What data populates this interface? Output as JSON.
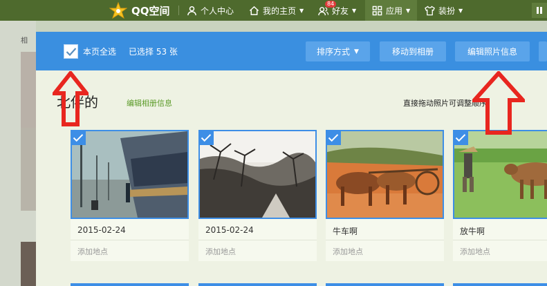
{
  "topnav": {
    "brand": "QQ空间",
    "items": [
      {
        "label": "个人中心"
      },
      {
        "label": "我的主页"
      },
      {
        "label": "好友",
        "badge": "84"
      },
      {
        "label": "应用"
      },
      {
        "label": "装扮"
      }
    ]
  },
  "background": {
    "char": "相"
  },
  "toolbar": {
    "select_all_label": "本页全选",
    "selected_count": "已选择 53 张",
    "sort_label": "排序方式",
    "move_label": "移动到相册",
    "edit_label": "编辑照片信息"
  },
  "album": {
    "title": "北伴的",
    "edit_link": "编辑相册信息",
    "drag_hint": "直接拖动照片可调整顺序"
  },
  "photos": [
    {
      "caption": "2015-02-24",
      "location_placeholder": "添加地点"
    },
    {
      "caption": "2015-02-24",
      "location_placeholder": "添加地点"
    },
    {
      "caption": "牛车啊",
      "location_placeholder": "添加地点"
    },
    {
      "caption": "放牛啊",
      "location_placeholder": "添加地点"
    }
  ],
  "colors": {
    "nav_bg": "#4e6a2d",
    "toolbar_bg": "#3a8fe0",
    "selection_blue": "#3d8ee6",
    "arrow_red": "#e8261f",
    "link_green": "#5a9a27"
  }
}
